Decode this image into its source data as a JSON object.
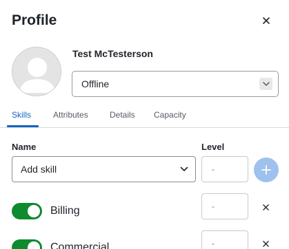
{
  "header": {
    "title": "Profile",
    "close_icon": "close-icon"
  },
  "user": {
    "name": "Test McTesterson",
    "avatar_icon": "user-avatar-icon"
  },
  "status": {
    "value": "Offline"
  },
  "tabs": [
    {
      "label": "Skills",
      "active": true
    },
    {
      "label": "Attributes",
      "active": false
    },
    {
      "label": "Details",
      "active": false
    },
    {
      "label": "Capacity",
      "active": false
    }
  ],
  "skills": {
    "name_header": "Name",
    "level_header": "Level",
    "add_placeholder": "Add skill",
    "add_level_placeholder": "-",
    "add_icon": "plus-icon",
    "items": [
      {
        "label": "Billing",
        "enabled": true,
        "level": "-"
      },
      {
        "label": "Commercial",
        "enabled": true,
        "level": "-"
      }
    ]
  },
  "colors": {
    "accent": "#1565c0",
    "toggle_on": "#0e8a2f",
    "add_button": "#9ec1ee"
  }
}
